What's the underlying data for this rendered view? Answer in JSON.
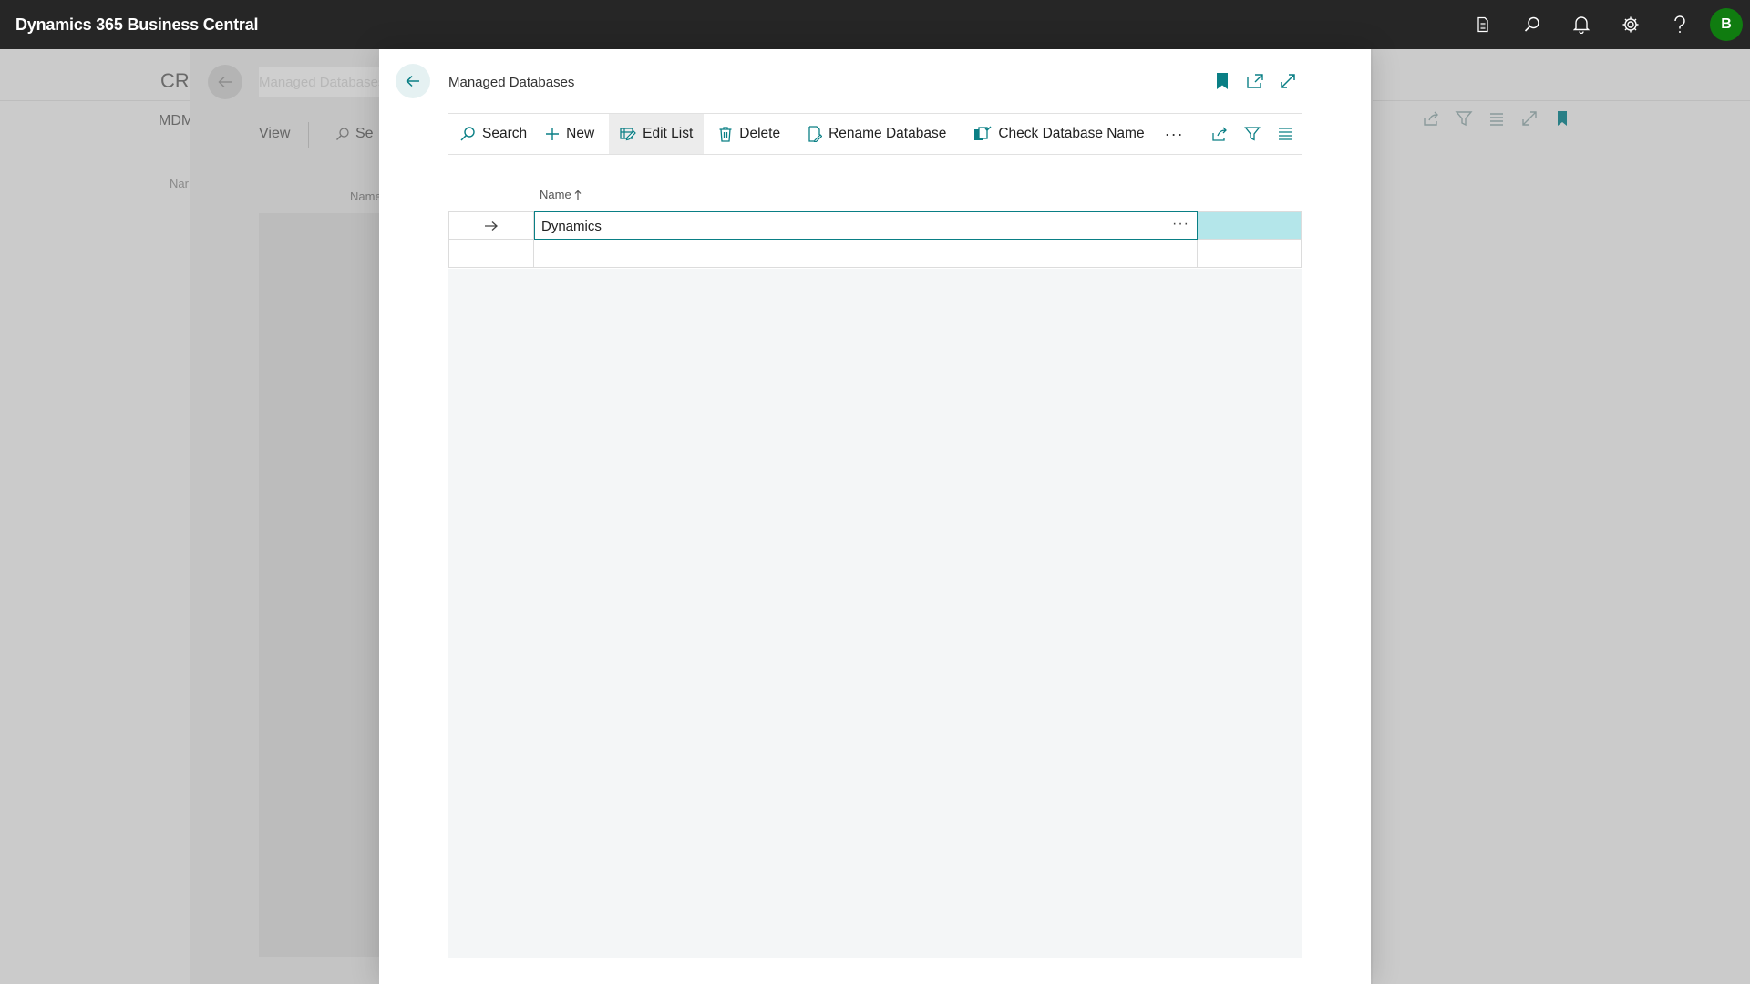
{
  "appbar": {
    "title": "Dynamics 365 Business Central",
    "avatar_initial": "B",
    "icons": [
      "document-icon",
      "search-icon",
      "bell-icon",
      "gear-icon",
      "help-icon"
    ]
  },
  "background_page": {
    "breadcrumb": "CR",
    "subnav": "MDM",
    "name_label": "Nar"
  },
  "background_dialog": {
    "title": "Managed Databases",
    "view_label": "View",
    "search_label": "Se",
    "name_label": "Name"
  },
  "dialog": {
    "title": "Managed Databases",
    "actions": {
      "search": "Search",
      "new": "New",
      "edit_list": "Edit List",
      "delete": "Delete",
      "rename": "Rename Database",
      "check": "Check Database Name",
      "more": "···"
    },
    "columns": {
      "name": "Name"
    },
    "rows": [
      {
        "name": "Dynamics",
        "selected": true
      },
      {
        "name": "",
        "selected": false
      }
    ],
    "lookup_dots": "···"
  },
  "colors": {
    "accent": "#0a7f85",
    "appbar_bg": "#262626",
    "avatar_bg": "#107c10",
    "selected_cell": "#b4e6ea"
  }
}
